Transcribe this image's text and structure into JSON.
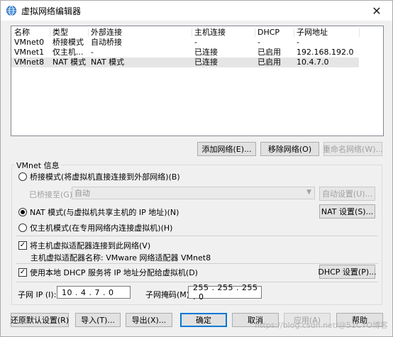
{
  "window": {
    "title": "虚拟网络编辑器",
    "close": "✕"
  },
  "list": {
    "headers": [
      "名称",
      "类型",
      "外部连接",
      "主机连接",
      "DHCP",
      "子网地址"
    ],
    "rows": [
      [
        "VMnet0",
        "桥接模式",
        "自动桥接",
        "-",
        "-",
        "-"
      ],
      [
        "VMnet1",
        "仅主机...",
        "-",
        "已连接",
        "已启用",
        "192.168.192.0"
      ],
      [
        "VMnet8",
        "NAT 模式",
        "NAT 模式",
        "已连接",
        "已启用",
        "10.4.7.0"
      ]
    ]
  },
  "list_buttons": {
    "add": "添加网络(E)...",
    "remove": "移除网络(O)",
    "rename": "重命名网络(W)..."
  },
  "vmnet_info": {
    "group_label": "VMnet 信息",
    "bridged_radio": "桥接模式(将虚拟机直接连接到外部网络)(B)",
    "bridged_to_label": "已桥接至(G):",
    "bridged_to_value": "自动",
    "auto_settings": "自动设置(U)...",
    "nat_radio": "NAT 模式(与虚拟机共享主机的 IP 地址)(N)",
    "nat_settings": "NAT 设置(S)...",
    "hostonly_radio": "仅主机模式(在专用网络内连接虚拟机)(H)",
    "connect_adapter_check": "将主机虚拟适配器连接到此网络(V)",
    "adapter_name": "主机虚拟适配器名称: VMware 网络适配器 VMnet8",
    "dhcp_check": "使用本地 DHCP 服务将 IP 地址分配给虚拟机(D)",
    "dhcp_settings": "DHCP 设置(P)...",
    "subnet_ip_label": "子网 IP (I):",
    "subnet_ip_value": "10 . 4 . 7 . 0",
    "subnet_mask_label": "子网掩码(M):",
    "subnet_mask_value": "255 . 255 . 255 . 0"
  },
  "bottom_buttons": {
    "restore": "还原默认设置(R)",
    "import": "导入(T)...",
    "export": "导出(X)...",
    "ok": "确定",
    "cancel": "取消",
    "apply": "应用(A)",
    "help": "帮助"
  },
  "watermark": "https://blog.csdn.net/@51CTO博客",
  "state": {
    "selected_row": "VMnet8",
    "mode": "nat",
    "connect_adapter": true,
    "use_dhcp": true
  }
}
